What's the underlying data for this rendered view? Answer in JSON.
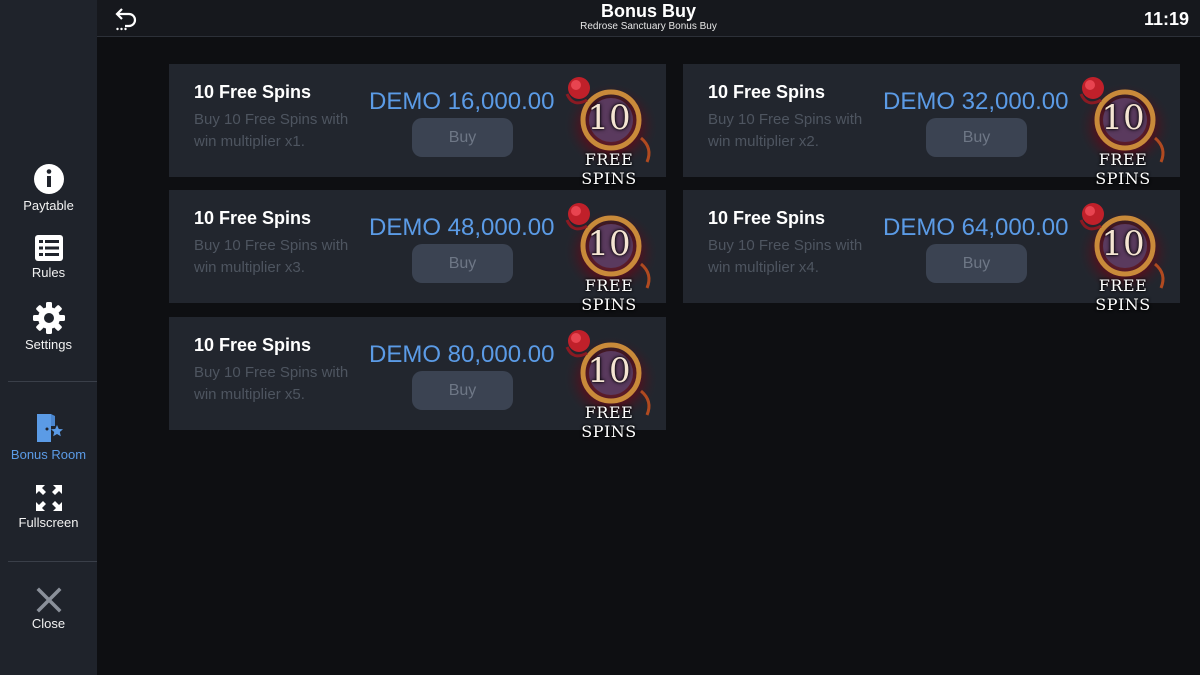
{
  "header": {
    "title": "Bonus Buy",
    "subtitle": "Redrose Sanctuary Bonus Buy",
    "time": "11:19"
  },
  "sidebar": {
    "items": [
      {
        "label": "Paytable",
        "icon": "info-icon"
      },
      {
        "label": "Rules",
        "icon": "list-icon"
      },
      {
        "label": "Settings",
        "icon": "gear-icon"
      },
      {
        "label": "Bonus Room",
        "icon": "bonus-room-icon",
        "active": true
      },
      {
        "label": "Fullscreen",
        "icon": "fullscreen-icon"
      },
      {
        "label": "Close",
        "icon": "close-icon"
      }
    ]
  },
  "cards": [
    {
      "title": "10 Free Spins",
      "desc": "Buy 10 Free Spins with win multiplier x1.",
      "price": "DEMO 16,000.00",
      "button": "Buy",
      "art_number": "10",
      "art_text": "FREE SPINS"
    },
    {
      "title": "10 Free Spins",
      "desc": "Buy 10 Free Spins with win multiplier x2.",
      "price": "DEMO 32,000.00",
      "button": "Buy",
      "art_number": "10",
      "art_text": "FREE SPINS"
    },
    {
      "title": "10 Free Spins",
      "desc": "Buy 10 Free Spins with win multiplier x3.",
      "price": "DEMO 48,000.00",
      "button": "Buy",
      "art_number": "10",
      "art_text": "FREE SPINS"
    },
    {
      "title": "10 Free Spins",
      "desc": "Buy 10 Free Spins with win multiplier x4.",
      "price": "DEMO 64,000.00",
      "button": "Buy",
      "art_number": "10",
      "art_text": "FREE SPINS"
    },
    {
      "title": "10 Free Spins",
      "desc": "Buy 10 Free Spins with win multiplier x5.",
      "price": "DEMO 80,000.00",
      "button": "Buy",
      "art_number": "10",
      "art_text": "FREE SPINS"
    }
  ],
  "colors": {
    "accent": "#5b9be6",
    "sidebar_bg": "#1f232b",
    "card_bg": "#22262e",
    "page_bg": "#0e0f12"
  }
}
